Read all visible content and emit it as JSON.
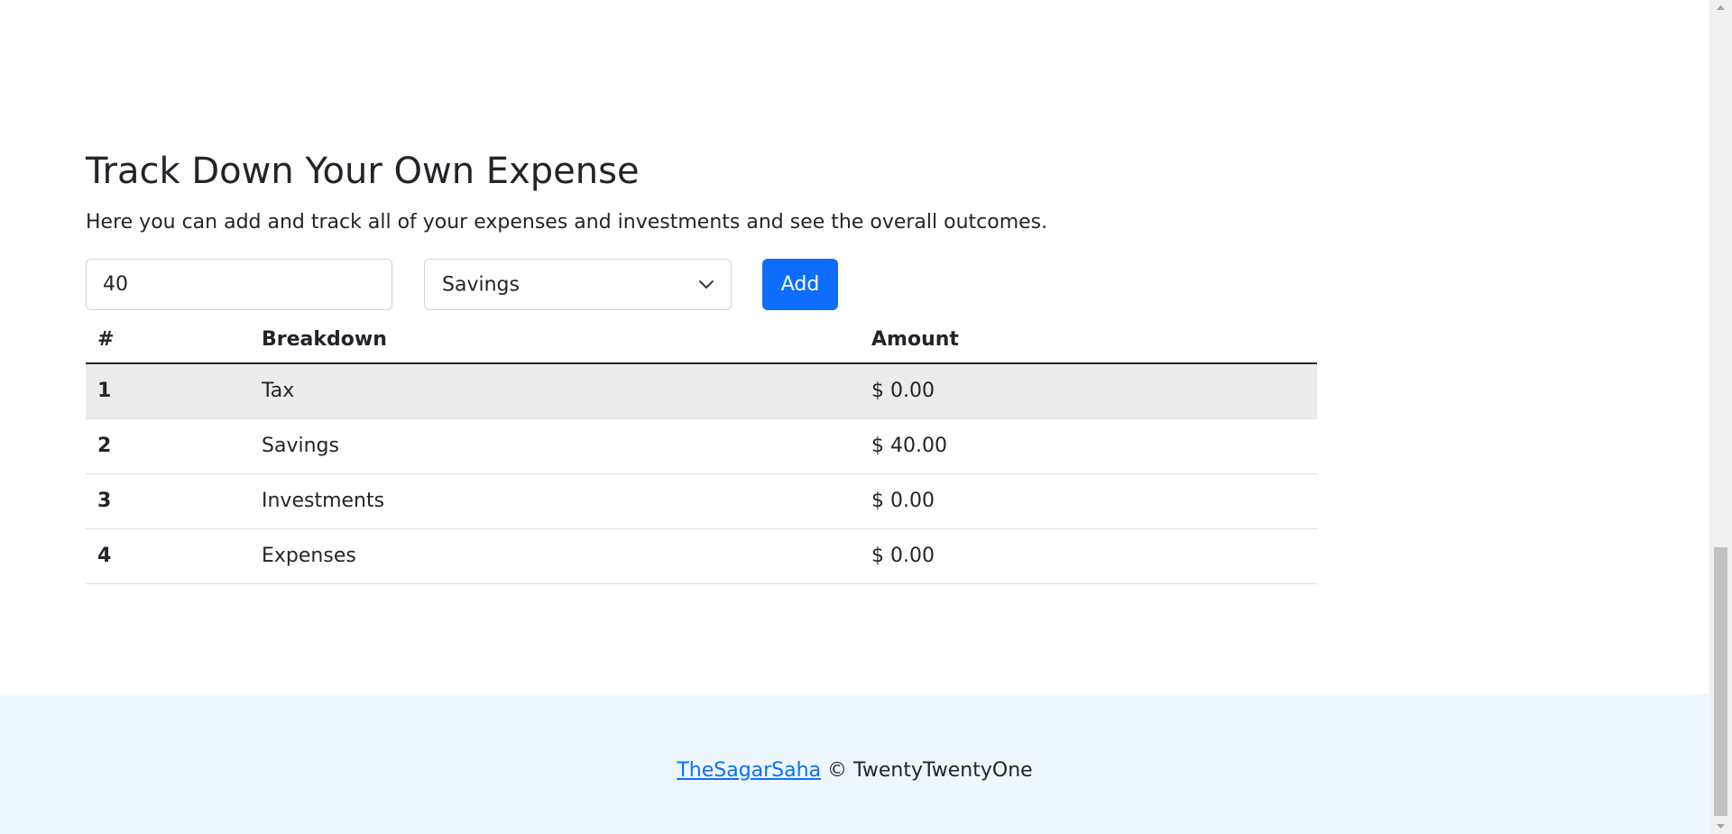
{
  "header": {
    "title": "Track Down Your Own Expense",
    "description": "Here you can add and track all of your expenses and investments and see the overall outcomes."
  },
  "form": {
    "amount_value": "40",
    "category_selected": "Savings",
    "category_options": [
      "Savings"
    ],
    "add_label": "Add"
  },
  "table": {
    "columns": [
      "#",
      "Breakdown",
      "Amount"
    ],
    "rows": [
      {
        "index": "1",
        "label": "Tax",
        "amount": "$ 0.00"
      },
      {
        "index": "2",
        "label": "Savings",
        "amount": "$ 40.00"
      },
      {
        "index": "3",
        "label": "Investments",
        "amount": "$ 0.00"
      },
      {
        "index": "4",
        "label": "Expenses",
        "amount": "$ 0.00"
      }
    ]
  },
  "footer": {
    "link_text": "TheSagarSaha",
    "copyright": " © TwentyTwentyOne"
  },
  "colors": {
    "primary": "#0d6efd",
    "footer_bg": "#eef7fd",
    "shaded_row": "#ececec",
    "text": "#212529"
  },
  "icons": {
    "select_chevron": "chevron-down-icon",
    "scroll_up": "scroll-up-arrow-icon",
    "scroll_down": "scroll-down-arrow-icon"
  }
}
